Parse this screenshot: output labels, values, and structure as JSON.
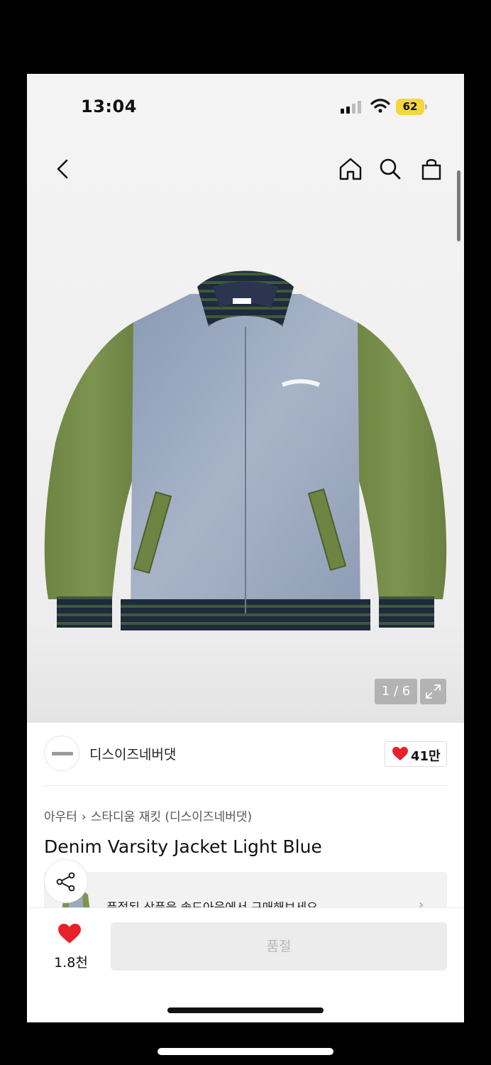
{
  "status_bar": {
    "time": "13:04",
    "battery_level": "62",
    "battery_color": "#f5d63c",
    "icons": [
      "signal-icon",
      "wifi-icon",
      "battery-icon"
    ]
  },
  "nav": {
    "icons": [
      "back-icon",
      "home-icon",
      "search-icon",
      "shopping-bag-icon"
    ]
  },
  "gallery": {
    "counter": "1 / 6",
    "icons": [
      "expand-icon"
    ]
  },
  "brand": {
    "name": "디스이즈네버댓",
    "like_count": "41만",
    "like_color": "#e8202a"
  },
  "breadcrumb": {
    "category": "아우터",
    "subcategory": "스타디움 재킷 (디스이즈네버댓)"
  },
  "product": {
    "title": "Denim Varsity Jacket Light Blue"
  },
  "soldout_banner": {
    "text": "품절된 상품을 솔드아웃에서 구매해보세요."
  },
  "bottom_bar": {
    "wish_count": "1.8천",
    "action_label": "품절"
  }
}
